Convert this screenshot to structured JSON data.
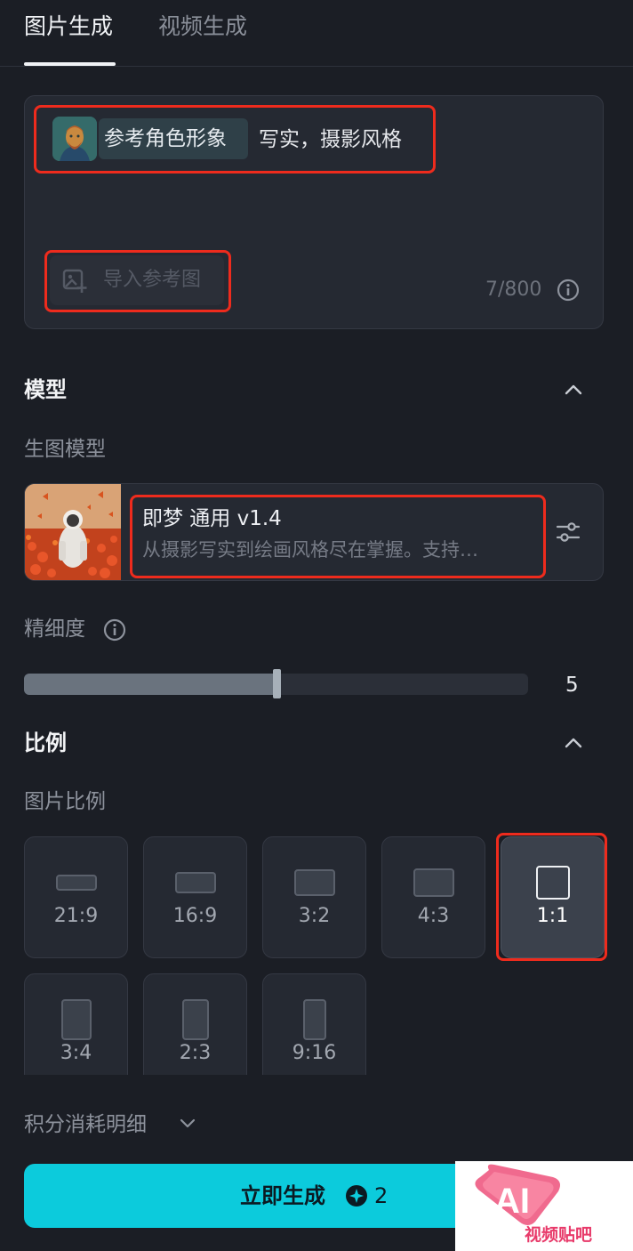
{
  "tabs": [
    {
      "label": "图片生成",
      "active": true
    },
    {
      "label": "视频生成",
      "active": false
    }
  ],
  "prompt": {
    "reference_chip": "参考角色形象",
    "text": "写实，摄影风格",
    "import_label": "导入参考图",
    "char_count": "7/800"
  },
  "model_section": {
    "title": "模型",
    "sub_label": "生图模型",
    "model_name": "即梦 通用 v1.4",
    "model_desc": "从摄影写实到绘画风格尽在掌握。支持…"
  },
  "detail": {
    "label": "精细度",
    "value": "5",
    "level_fraction": 0.5
  },
  "ratio_section": {
    "title": "比例",
    "sub_label": "图片比例",
    "options": [
      {
        "label": "21:9",
        "selected": false
      },
      {
        "label": "16:9",
        "selected": false
      },
      {
        "label": "3:2",
        "selected": false
      },
      {
        "label": "4:3",
        "selected": false
      },
      {
        "label": "1:1",
        "selected": true
      },
      {
        "label": "3:4",
        "selected": false
      },
      {
        "label": "2:3",
        "selected": false
      },
      {
        "label": "9:16",
        "selected": false
      }
    ]
  },
  "points_label": "积分消耗明细",
  "generate": {
    "label": "立即生成",
    "cost": "2"
  },
  "watermark": {
    "logo_text": "AI",
    "text": "视频贴吧"
  },
  "colors": {
    "accent": "#0ccbdc",
    "highlight_annotation": "#ee2b1d",
    "background": "#1b1e25"
  }
}
